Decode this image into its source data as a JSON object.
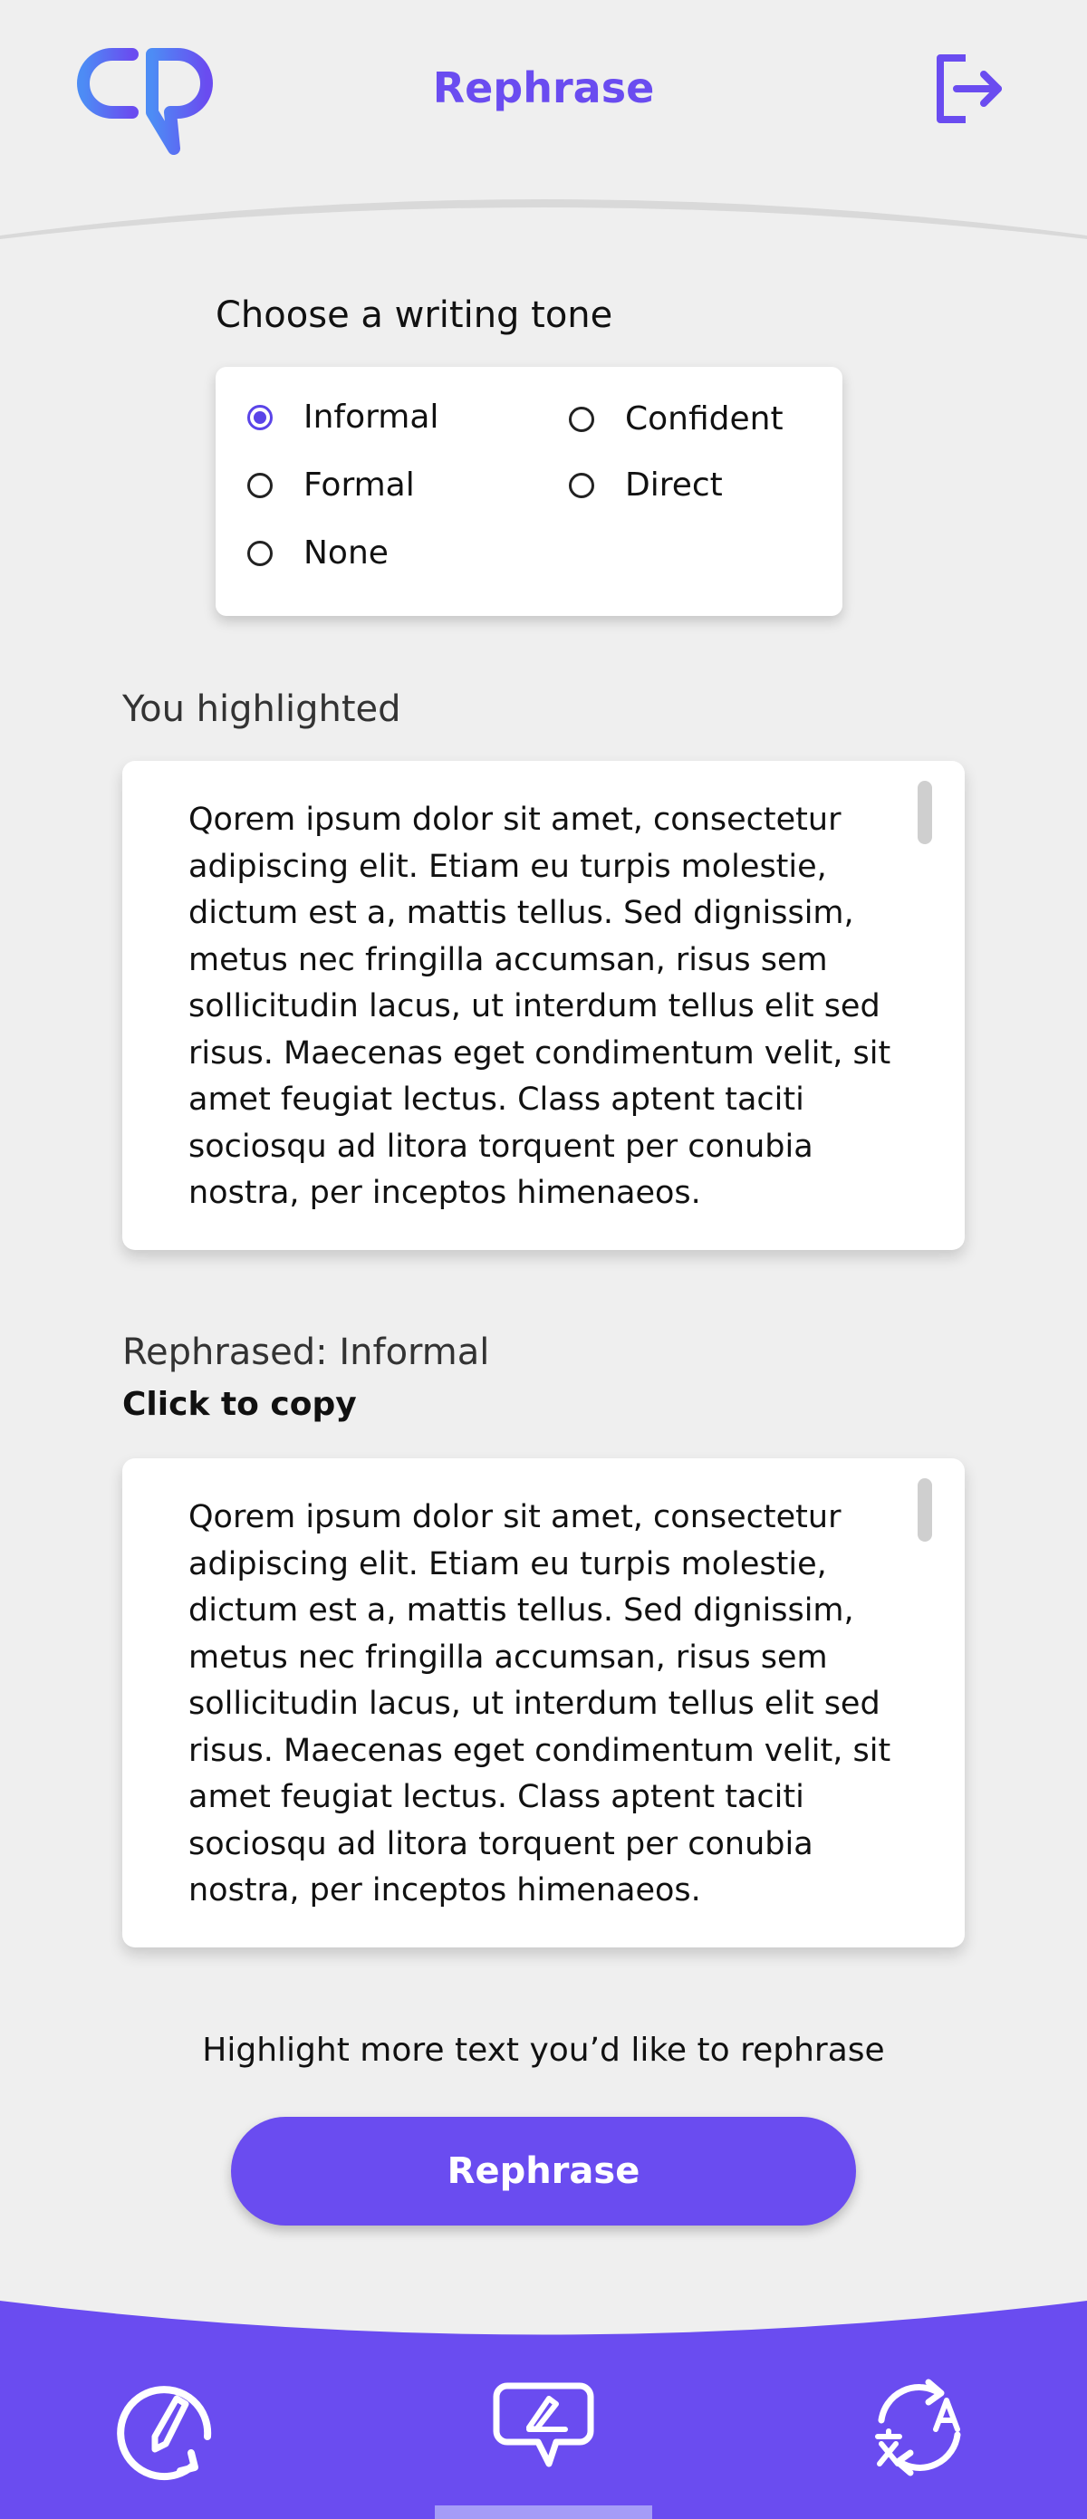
{
  "header": {
    "title": "Rephrase"
  },
  "tone": {
    "label": "Choose a writing tone",
    "options": [
      "Informal",
      "Confident",
      "Formal",
      "Direct",
      "None"
    ],
    "selected": "Informal"
  },
  "highlighted": {
    "label": "You highlighted",
    "text": "Qorem ipsum dolor sit amet, consectetur adipiscing elit. Etiam eu turpis molestie, dictum est a, mattis tellus. Sed dignissim, metus nec fringilla accumsan, risus sem sollicitudin lacus, ut interdum tellus elit sed risus. Maecenas eget condimentum velit, sit amet feugiat lectus. Class aptent taciti sociosqu ad litora torquent per conubia nostra, per inceptos himenaeos."
  },
  "rephrased": {
    "label": "Rephrased: Informal",
    "copy_hint": "Click to copy",
    "text": "Qorem ipsum dolor sit amet, consectetur adipiscing elit. Etiam eu turpis molestie, dictum est a, mattis tellus. Sed dignissim, metus nec fringilla accumsan, risus sem sollicitudin lacus, ut interdum tellus elit sed risus. Maecenas eget condimentum velit, sit amet feugiat lectus. Class aptent taciti sociosqu ad litora torquent per conubia nostra, per inceptos himenaeos."
  },
  "action": {
    "hint": "Highlight more text you’d like to rephrase",
    "button_label": "Rephrase"
  },
  "nav": {
    "items": [
      {
        "icon": "write-icon",
        "active": false
      },
      {
        "icon": "rephrase-chat-icon",
        "active": true
      },
      {
        "icon": "translate-icon",
        "active": false
      }
    ]
  },
  "colors": {
    "accent": "#6a4cf0",
    "background": "#efefef",
    "nav_indicator": "#a59cf7"
  }
}
